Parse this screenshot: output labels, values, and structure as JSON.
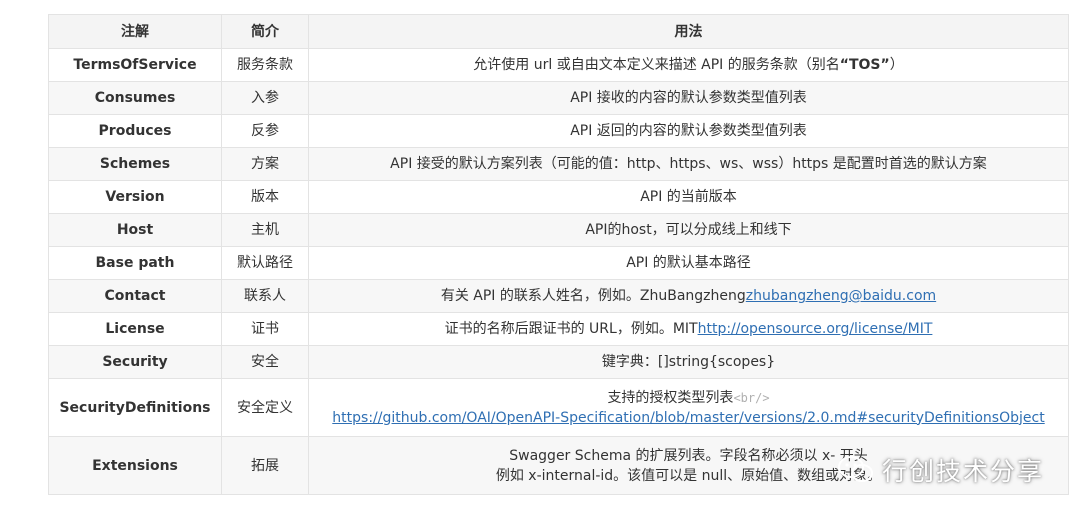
{
  "headers": [
    "注解",
    "简介",
    "用法"
  ],
  "rows": [
    {
      "name": "TermsOfService",
      "brief": "服务条款",
      "usage": "允许使用 url 或自由文本定义来描述 API 的服务条款（别名",
      "usage_bold": "“TOS”",
      "usage_tail": "）"
    },
    {
      "name": "Consumes",
      "brief": "入参",
      "usage": "API 接收的内容的默认参数类型值列表"
    },
    {
      "name": "Produces",
      "brief": "反参",
      "usage": "API 返回的内容的默认参数类型值列表"
    },
    {
      "name": "Schemes",
      "brief": "方案",
      "usage": "API 接受的默认方案列表（可能的值：http、https、ws、wss）https 是配置时首选的默认方案"
    },
    {
      "name": "Version",
      "brief": "版本",
      "usage": "API 的当前版本"
    },
    {
      "name": "Host",
      "brief": "主机",
      "usage": "API的host，可以分成线上和线下"
    },
    {
      "name": "Base path",
      "brief": "默认路径",
      "usage": "API 的默认基本路径"
    },
    {
      "name": "Contact",
      "brief": "联系人",
      "usage": "有关 API 的联系人姓名，例如。ZhuBangzheng",
      "usage_link": "zhubangzheng@baidu.com"
    },
    {
      "name": "License",
      "brief": "证书",
      "usage": "证书的名称后跟证书的 URL，例如。MIT",
      "usage_link": "http://opensource.org/license/MIT"
    },
    {
      "name": "Security",
      "brief": "安全",
      "usage": "键字典：[]string{scopes}"
    },
    {
      "name": "SecurityDefinitions",
      "brief": "安全定义",
      "usage": "支持的授权类型列表",
      "usage_tag": "<br/>",
      "usage_link": "https://github.com/OAI/OpenAPI-Specification/blob/master/versions/2.0.md#securityDefinitionsObject"
    },
    {
      "name": "Extensions",
      "brief": "拓展",
      "usage": "Swagger Schema 的扩展列表。字段名称必须以 x- 开头",
      "usage_line2": "例如 x-internal-id。该值可以是 null、原始值、数组或对象。"
    }
  ],
  "watermark": {
    "text": "行创技术分享",
    "icon": "wechat-icon"
  }
}
